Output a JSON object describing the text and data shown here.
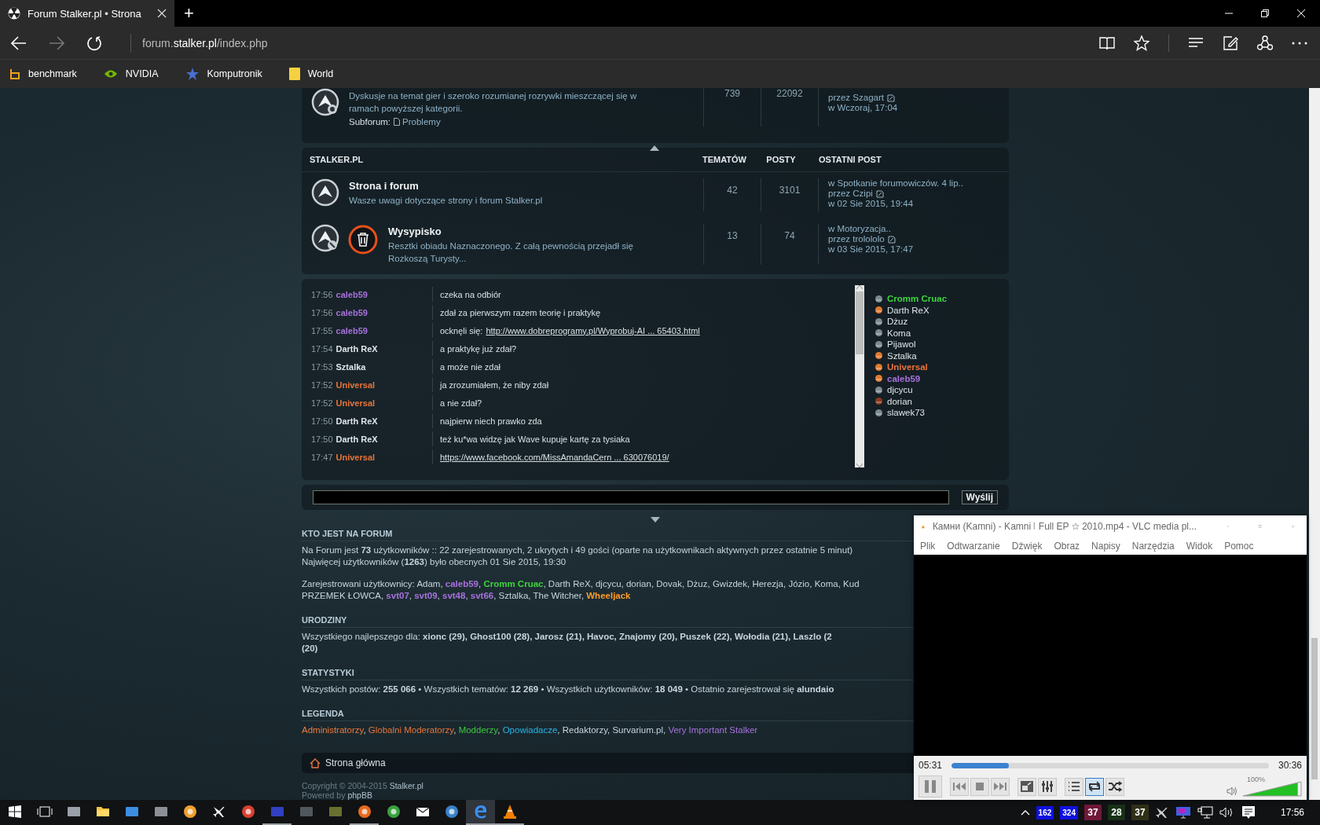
{
  "browser": {
    "tab": {
      "title": "Forum Stalker.pl • Strona",
      "selected": true
    },
    "new_tab": "+",
    "address": {
      "subdomain": "forum.",
      "domain": "stalker.pl",
      "path": "/index.php"
    },
    "bookmarks": [
      {
        "label": "benchmark",
        "kind": "b"
      },
      {
        "label": "NVIDIA",
        "kind": "nvidia"
      },
      {
        "label": "Komputronik",
        "kind": "star"
      },
      {
        "label": "World",
        "kind": "folder"
      }
    ]
  },
  "top_forum": {
    "description": "Dyskusje na temat gier i szeroko rozumianej rozrywki mieszczącej się w ramach powyższej kategorii.",
    "subforum_label": "Subforum:",
    "subforum": "Problemy",
    "topics": "739",
    "posts": "22092",
    "author_line": "przez Szagart",
    "date": "w Wczoraj, 17:04"
  },
  "category": {
    "title": "STALKER.PL",
    "columns": [
      "TEMATÓW",
      "POSTY",
      "OSTATNI POST"
    ],
    "forums": [
      {
        "kind": "plain",
        "title": "Strona i forum",
        "description": "Wasze uwagi dotyczące strony i forum Stalker.pl",
        "topics": "42",
        "posts": "3101",
        "last_topic": "w Spotkanie forumowiczów. 4 lip..",
        "author_line": "przez Czipi",
        "date": "w 02 Sie 2015, 19:44"
      },
      {
        "kind": "trash",
        "title": "Wysypisko",
        "description": "Resztki obiadu Naznaczonego. Z całą pewnością przejadł się Rozkoszą Turysty...",
        "topics": "13",
        "posts": "74",
        "last_topic": "w Motoryzacja..",
        "author_line": "przez trolololo",
        "date": "w 03 Sie 2015, 17:47"
      }
    ]
  },
  "chat": {
    "messages": [
      {
        "time": "17:56",
        "author": "caleb59",
        "color": "#a872dc",
        "kind": "text",
        "text": "czeka na odbiór"
      },
      {
        "time": "17:56",
        "author": "caleb59",
        "color": "#a872dc",
        "kind": "text",
        "text": "zdał za pierwszym razem teorię i praktykę"
      },
      {
        "time": "17:55",
        "author": "caleb59",
        "color": "#a872dc",
        "kind": "link",
        "prefix": "ocknęli się:",
        "text": "http://www.dobreprogramy.pl/Wyprobuj-AI ... 65403.html"
      },
      {
        "time": "17:54",
        "author": "Darth ReX",
        "color": "#dfe6ea",
        "kind": "text",
        "text": "a praktykę już zdał?"
      },
      {
        "time": "17:53",
        "author": "Sztalka",
        "color": "#dfe6ea",
        "kind": "text",
        "text": "a może nie zdał"
      },
      {
        "time": "17:52",
        "author": "Universal",
        "color": "#e8743a",
        "kind": "text",
        "text": "ja zrozumiałem, że niby zdał"
      },
      {
        "time": "17:52",
        "author": "Universal",
        "color": "#e8743a",
        "kind": "text",
        "text": "a nie zdał?"
      },
      {
        "time": "17:50",
        "author": "Darth ReX",
        "color": "#dfe6ea",
        "kind": "text",
        "text": "najpierw niech prawko zda"
      },
      {
        "time": "17:50",
        "author": "Darth ReX",
        "color": "#dfe6ea",
        "kind": "text",
        "text": "też ku*wa widzę jak Wave kupuje kartę za tysiaka"
      },
      {
        "time": "17:47",
        "author": "Universal",
        "color": "#e8743a",
        "kind": "link",
        "text": "https://www.facebook.com/MissAmandaCern ... 630076019/"
      }
    ],
    "users": [
      {
        "name": "Cromm Cruac",
        "color": "#3fd43f",
        "bold": true,
        "kind": "cool"
      },
      {
        "name": "Darth ReX",
        "color": "#dfe6ea",
        "bold": false,
        "kind": "warm"
      },
      {
        "name": "Dżuz",
        "color": "#dfe6ea",
        "bold": false,
        "kind": "cool"
      },
      {
        "name": "Koma",
        "color": "#dfe6ea",
        "bold": false,
        "kind": "cool"
      },
      {
        "name": "Pijawol",
        "color": "#dfe6ea",
        "bold": false,
        "kind": "cool"
      },
      {
        "name": "Sztalka",
        "color": "#dfe6ea",
        "bold": false,
        "kind": "warm"
      },
      {
        "name": "Universal",
        "color": "#e8743a",
        "bold": true,
        "kind": "warm"
      },
      {
        "name": "caleb59",
        "color": "#a872dc",
        "bold": true,
        "kind": "warm"
      },
      {
        "name": "djcycu",
        "color": "#dfe6ea",
        "bold": false,
        "kind": "cool"
      },
      {
        "name": "dorian",
        "color": "#dfe6ea",
        "bold": false,
        "kind": "dark"
      },
      {
        "name": "slawek73",
        "color": "#dfe6ea",
        "bold": false,
        "kind": "cool"
      }
    ],
    "send_button": "Wyślij"
  },
  "who_is_online": {
    "title": "KTO JEST NA FORUM",
    "lines": [
      "Na Forum jest **73** użytkowników :: 22 zarejestrowanych, 2 ukrytych i 49 gości (oparte na użytkownikach aktywnych przez ostatnie 5 minut)",
      "Najwięcej użytkowników (**1263**) było obecnych 01 Sie 2015, 19:30"
    ],
    "registered_label": "Zarejestrowani użytkownicy:",
    "separator": ",",
    "registered_lines": [
      [
        {
          "name": "Adam",
          "color": "#c8d4dc",
          "bold": false
        },
        {
          "name": "caleb59",
          "color": "#a872dc",
          "bold": true
        },
        {
          "name": "Cromm Cruac",
          "color": "#3fd43f",
          "bold": true
        },
        {
          "name": "Darth ReX",
          "color": "#c8d4dc",
          "bold": false
        },
        {
          "name": "djcycu",
          "color": "#c8d4dc",
          "bold": false
        },
        {
          "name": "dorian",
          "color": "#c8d4dc",
          "bold": false
        },
        {
          "name": "Dovak",
          "color": "#c8d4dc",
          "bold": false
        },
        {
          "name": "Dżuz",
          "color": "#c8d4dc",
          "bold": false
        },
        {
          "name": "Gwizdek",
          "color": "#c8d4dc",
          "bold": false
        },
        {
          "name": "Herezja",
          "color": "#c8d4dc",
          "bold": false
        },
        {
          "name": "Józio",
          "color": "#c8d4dc",
          "bold": false
        },
        {
          "name": "Koma",
          "color": "#c8d4dc",
          "bold": false
        },
        {
          "name": "Kud",
          "color": "#c8d4dc",
          "bold": false
        }
      ],
      [
        {
          "name": "PRZEMEK ŁOWCA",
          "color": "#c8d4dc",
          "bold": false
        },
        {
          "name": "svt07",
          "color": "#a872dc",
          "bold": true
        },
        {
          "name": "svt09",
          "color": "#a872dc",
          "bold": true
        },
        {
          "name": "svt48",
          "color": "#a872dc",
          "bold": true
        },
        {
          "name": "svt66",
          "color": "#a872dc",
          "bold": true
        },
        {
          "name": "Sztalka",
          "color": "#c8d4dc",
          "bold": false
        },
        {
          "name": "The Witcher",
          "color": "#c8d4dc",
          "bold": false
        },
        {
          "name": "Wheeljack",
          "color": "#ff9a2a",
          "bold": true
        }
      ]
    ]
  },
  "birthdays": {
    "title": "URODZINY",
    "lines": [
      {
        "text": "Wszystkiego najlepszego dla: **xionc (29), Ghost100 (28), Jarosz (21), Havoc, Znajomy (20), Puszek (22), Wołodia (21), Laszlo (2**",
        "bold": false
      },
      {
        "text": "(20)",
        "bold": true
      }
    ]
  },
  "statistics": {
    "title": "STATYSTYKI",
    "text": "Wszystkich postów: **255 066** • Wszystkich tematów: **12 269** • Wszystkich użytkowników: **18 049** • Ostatnio zarejestrował się **alundaio**"
  },
  "legend": {
    "title": "LEGENDA",
    "separator": ",",
    "groups": [
      {
        "name": "Administratorzy",
        "color": "#ee7a3c"
      },
      {
        "name": "Globalni Moderatorzy",
        "color": "#e8743a"
      },
      {
        "name": "Modderzy",
        "color": "#3fc83f"
      },
      {
        "name": "Opowiadacze",
        "color": "#2ab4e6"
      },
      {
        "name": "Redaktorzy",
        "color": "#c8d4dc"
      },
      {
        "name": "Survarium.pl",
        "color": "#c8d4dc"
      },
      {
        "name": "Very Important Stalker",
        "color": "#a872dc"
      }
    ]
  },
  "footer": {
    "home_link": "Strona główna",
    "copyright": "Copyright © 2004-2015",
    "copyright_link": "Stalker.pl",
    "powered": "Powered by",
    "powered_link": "phpBB"
  },
  "vlc": {
    "title": "Камни (Kamni) - Kamni ⦚ Full EP ☆ 2010.mp4 - VLC media pl...",
    "menu": [
      "Plik",
      "Odtwarzanie",
      "Dźwięk",
      "Obraz",
      "Napisy",
      "Narzędzia",
      "Widok",
      "Pomoc"
    ],
    "elapsed": "05:31",
    "total": "30:36",
    "progress": {
      "level": 0.18
    },
    "volume": {
      "reading": "100%",
      "level": 0.93
    },
    "buttons": [
      {
        "kind": "pause",
        "on": false
      },
      {
        "kind": "prev",
        "on": false
      },
      {
        "kind": "stop",
        "on": false
      },
      {
        "kind": "next",
        "on": false
      },
      {
        "kind": "fullscreen",
        "on": false
      },
      {
        "kind": "settings",
        "on": false
      },
      {
        "kind": "playlist",
        "on": false
      },
      {
        "kind": "loop",
        "on": true
      },
      {
        "kind": "shuffle",
        "on": false
      }
    ]
  },
  "taskbar": {
    "apps": [
      {
        "kind": "start",
        "running": false,
        "selected": false
      },
      {
        "kind": "taskview",
        "running": false,
        "selected": false
      },
      {
        "kind": "tile",
        "color": "#9aa0a8",
        "running": false,
        "selected": false
      },
      {
        "kind": "folder",
        "running": false,
        "selected": false
      },
      {
        "kind": "tile",
        "color": "#3c8ee0",
        "running": false,
        "selected": false
      },
      {
        "kind": "tile",
        "color": "#8c9096",
        "running": false,
        "selected": false
      },
      {
        "kind": "circle",
        "color": "#f0a030",
        "running": false,
        "selected": false
      },
      {
        "kind": "plane",
        "running": false,
        "selected": false
      },
      {
        "kind": "circle",
        "color": "#d84030",
        "running": false,
        "selected": false
      },
      {
        "kind": "tile",
        "color": "#3040c0",
        "running": true,
        "selected": false
      },
      {
        "kind": "tile",
        "color": "#50585e",
        "running": false,
        "selected": false
      },
      {
        "kind": "tile",
        "color": "#6a7030",
        "running": false,
        "selected": false
      },
      {
        "kind": "circle",
        "color": "#e86a20",
        "running": true,
        "selected": false
      },
      {
        "kind": "circle",
        "color": "#3aa040",
        "running": false,
        "selected": false
      },
      {
        "kind": "mail",
        "running": false,
        "selected": false
      },
      {
        "kind": "circle",
        "color": "#3a80c8",
        "running": false,
        "selected": false
      },
      {
        "kind": "edge",
        "running": true,
        "selected": true
      },
      {
        "kind": "cone",
        "running": true,
        "selected": false
      }
    ],
    "badges": [
      {
        "text": "162",
        "color": "#1010e0"
      },
      {
        "text": "324",
        "color": "#1010e0"
      },
      {
        "text": "37",
        "color": "#701838"
      },
      {
        "text": "28",
        "color": "#183018"
      },
      {
        "text": "37",
        "color": "#303018"
      }
    ],
    "clock": "17:56"
  }
}
